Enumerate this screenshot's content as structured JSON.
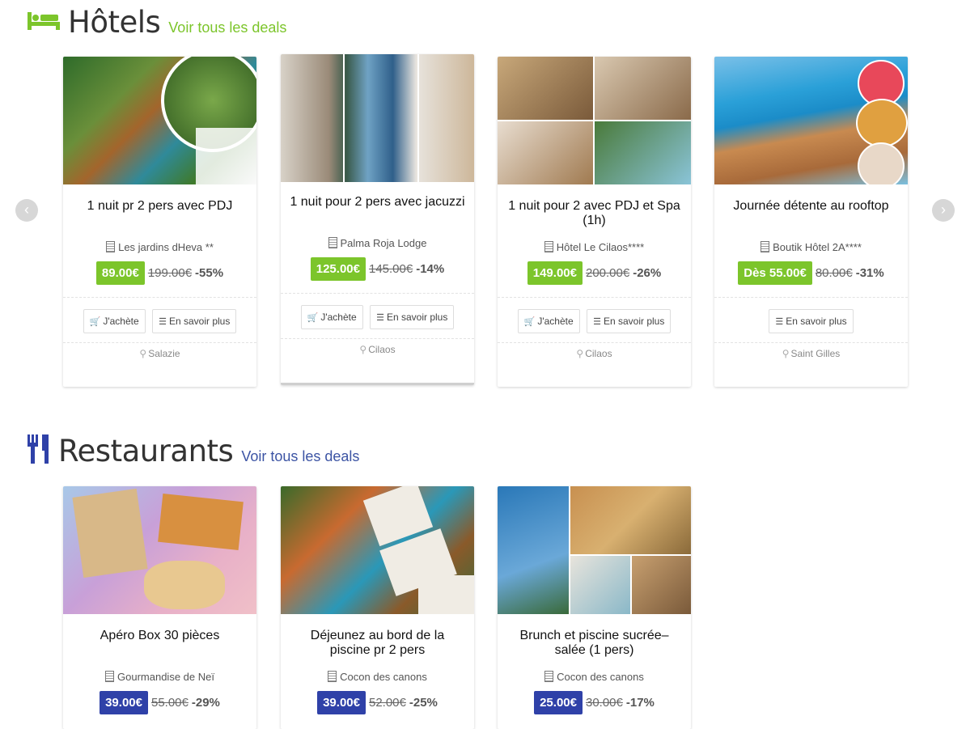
{
  "hotels": {
    "heading": "Hôtels",
    "see_all": "Voir tous les deals",
    "cards": [
      {
        "title": "1 nuit pr 2 pers avec PDJ",
        "place": "Les jardins dHeva **",
        "price": "89.00€",
        "old": "199.00€",
        "pct": "-55%",
        "buy": "J'achète",
        "more": "En savoir plus",
        "loc": "Salazie"
      },
      {
        "title": "1 nuit pour 2 pers avec jacuzzi",
        "place": "Palma Roja Lodge",
        "price": "125.00€",
        "old": "145.00€",
        "pct": "-14%",
        "buy": "J'achète",
        "more": "En savoir plus",
        "loc": "Cilaos"
      },
      {
        "title": "1 nuit pour 2 avec PDJ et Spa (1h)",
        "place": "Hôtel Le Cilaos****",
        "price": "149.00€",
        "old": "200.00€",
        "pct": "-26%",
        "buy": "J'achète",
        "more": "En savoir plus",
        "loc": "Cilaos"
      },
      {
        "title": "Journée détente au rooftop",
        "place": "Boutik Hôtel 2A****",
        "price": "Dès 55.00€",
        "old": "80.00€",
        "pct": "-31%",
        "more": "En savoir plus",
        "loc": "Saint Gilles"
      }
    ]
  },
  "restaurants": {
    "heading": "Restaurants",
    "see_all": "Voir tous les deals",
    "cards": [
      {
        "title": "Apéro Box 30 pièces",
        "place": "Gourmandise de Neï",
        "price": "39.00€",
        "old": "55.00€",
        "pct": "-29%"
      },
      {
        "title": "Déjeunez au bord de la piscine pr 2 pers",
        "place": "Cocon des canons",
        "price": "39.00€",
        "old": "52.00€",
        "pct": "-25%"
      },
      {
        "title": "Brunch et piscine sucrée–salée (1 pers)",
        "place": "Cocon des canons",
        "price": "25.00€",
        "old": "30.00€",
        "pct": "-17%"
      }
    ]
  },
  "colors": {
    "hotel_accent": "#7cc52b",
    "resto_accent": "#2f41a8"
  },
  "icons": {
    "hotels": "bed-icon",
    "restaurants": "fork-knife-icon",
    "prev": "chevron-left-icon",
    "next": "chevron-right-icon",
    "cart": "cart-icon",
    "menu": "list-icon",
    "building": "building-icon",
    "pin": "map-pin-icon"
  }
}
